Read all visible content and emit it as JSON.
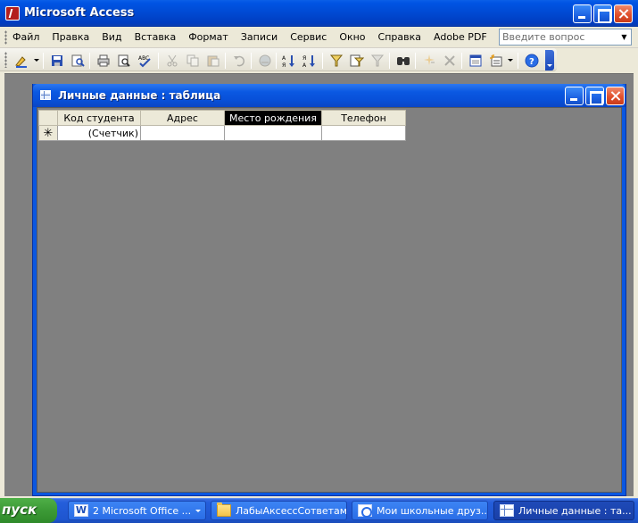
{
  "app": {
    "title": "Microsoft Access"
  },
  "menu": {
    "items": [
      "Файл",
      "Правка",
      "Вид",
      "Вставка",
      "Формат",
      "Записи",
      "Сервис",
      "Окно",
      "Справка",
      "Adobe PDF"
    ],
    "help_placeholder": "Введите вопрос"
  },
  "toolbar": {
    "icons": [
      "design-view-icon",
      "save-icon",
      "search-database-icon",
      "print-icon",
      "print-preview-icon",
      "spelling-icon",
      "cut-icon",
      "copy-icon",
      "paste-icon",
      "undo-icon",
      "insert-hyperlink-icon",
      "sort-ascending-icon",
      "sort-descending-icon",
      "filter-by-selection-icon",
      "filter-by-form-icon",
      "apply-filter-icon",
      "find-icon",
      "new-record-icon",
      "delete-record-icon",
      "database-window-icon",
      "new-object-icon",
      "help-icon"
    ]
  },
  "child_window": {
    "title": "Личные данные : таблица"
  },
  "datasheet": {
    "columns": [
      "Код студента",
      "Адрес",
      "Место рождения",
      "Телефон"
    ],
    "selected_column": "Место рождения",
    "new_row_marker": "✳",
    "new_row_values": [
      "(Счетчик)",
      "",
      "",
      ""
    ]
  },
  "taskbar": {
    "start_label": "пуск",
    "buttons": [
      {
        "label": "2 Microsoft Office ...",
        "icon": "word-icon",
        "icon_glyph": "W"
      },
      {
        "label": "ЛабыАксессСответами",
        "icon": "folder-icon"
      },
      {
        "label": "Мои школьные друз...",
        "icon": "browser-icon"
      },
      {
        "label": "Личные данные : та...",
        "icon": "table-icon"
      }
    ]
  },
  "colors": {
    "title_bar": "#0054e3",
    "mdi_background": "#808080",
    "start_button": "#3c9a36",
    "taskbar": "#245edb"
  }
}
